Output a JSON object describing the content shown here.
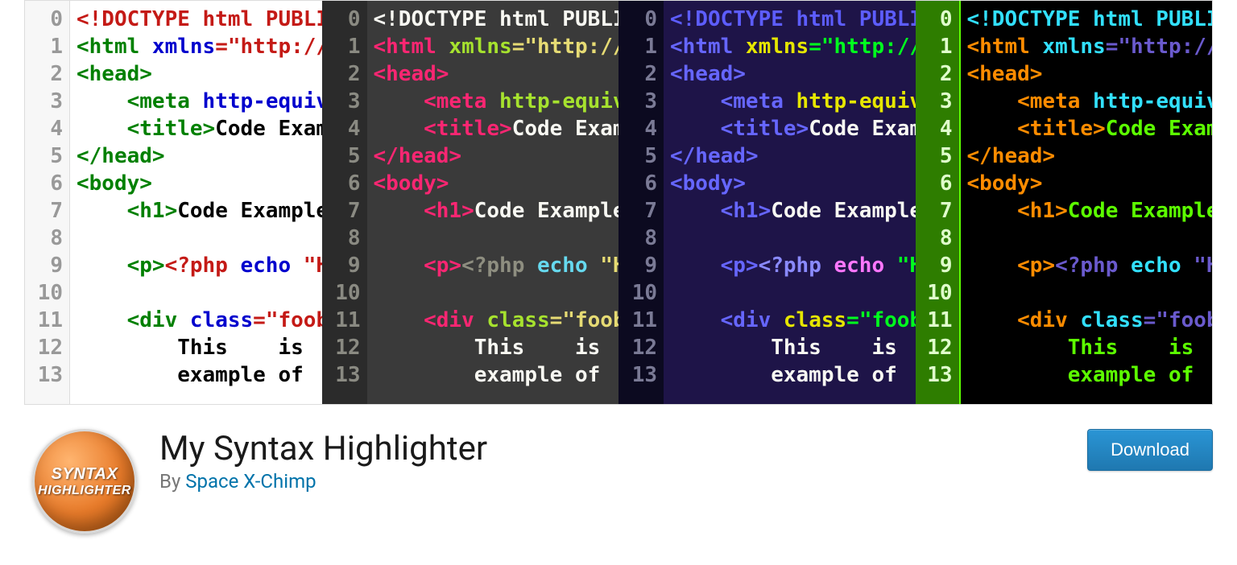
{
  "plugin": {
    "title": "My Syntax Highlighter",
    "by_prefix": "By ",
    "author": "Space X-Chimp",
    "download_label": "Download"
  },
  "logo": {
    "line1": "SYNTAX",
    "line2": "HIGHLIGHTER"
  },
  "panes": [
    {
      "id": "light",
      "gutter_start": 0,
      "gutter_end": 13,
      "tokens": [
        [
          {
            "t": "<!DOCTYPE html PUBLI",
            "c": "#c41a16"
          }
        ],
        [
          {
            "t": "<html ",
            "c": "#008000"
          },
          {
            "t": "xmlns",
            "c": "#0000cd"
          },
          {
            "t": "=\"http://",
            "c": "#c41a16"
          }
        ],
        [
          {
            "t": "<head>",
            "c": "#008000"
          }
        ],
        [
          {
            "t": "    <meta ",
            "c": "#008000"
          },
          {
            "t": "http-equiv",
            "c": "#0000cd"
          }
        ],
        [
          {
            "t": "    <title>",
            "c": "#008000"
          },
          {
            "t": "Code Exam",
            "c": "#000"
          }
        ],
        [
          {
            "t": "</head>",
            "c": "#008000"
          }
        ],
        [
          {
            "t": "<body>",
            "c": "#008000"
          }
        ],
        [
          {
            "t": "    <h1>",
            "c": "#008000"
          },
          {
            "t": "Code Example",
            "c": "#000"
          }
        ],
        [
          {
            "t": "",
            "c": "#000"
          }
        ],
        [
          {
            "t": "    <p>",
            "c": "#008000"
          },
          {
            "t": "<?php ",
            "c": "#c41a16"
          },
          {
            "t": "echo ",
            "c": "#0000cd"
          },
          {
            "t": "\"H",
            "c": "#c41a16"
          }
        ],
        [
          {
            "t": "",
            "c": "#000"
          }
        ],
        [
          {
            "t": "    <div ",
            "c": "#008000"
          },
          {
            "t": "class",
            "c": "#0000cd"
          },
          {
            "t": "=\"foob",
            "c": "#c41a16"
          }
        ],
        [
          {
            "t": "        This    is",
            "c": "#000"
          }
        ],
        [
          {
            "t": "        example of",
            "c": "#000"
          }
        ]
      ]
    },
    {
      "id": "dark",
      "gutter_start": 0,
      "gutter_end": 13,
      "tokens": [
        [
          {
            "t": "<!DOCTYPE html PUBLI",
            "c": "#f8f8f2"
          }
        ],
        [
          {
            "t": "<html ",
            "c": "#f92672"
          },
          {
            "t": "xmlns",
            "c": "#a6e22e"
          },
          {
            "t": "=\"http://",
            "c": "#e6db74"
          }
        ],
        [
          {
            "t": "<head>",
            "c": "#f92672"
          }
        ],
        [
          {
            "t": "    <meta ",
            "c": "#f92672"
          },
          {
            "t": "http-equiv",
            "c": "#a6e22e"
          }
        ],
        [
          {
            "t": "    <title>",
            "c": "#f92672"
          },
          {
            "t": "Code Exam",
            "c": "#f8f8f2"
          }
        ],
        [
          {
            "t": "</head>",
            "c": "#f92672"
          }
        ],
        [
          {
            "t": "<body>",
            "c": "#f92672"
          }
        ],
        [
          {
            "t": "    <h1>",
            "c": "#f92672"
          },
          {
            "t": "Code Example",
            "c": "#f8f8f2"
          }
        ],
        [
          {
            "t": "",
            "c": "#f8f8f2"
          }
        ],
        [
          {
            "t": "    <p>",
            "c": "#f92672"
          },
          {
            "t": "<?php ",
            "c": "#8e8e80"
          },
          {
            "t": "echo ",
            "c": "#66d9ef"
          },
          {
            "t": "\"H",
            "c": "#e6db74"
          }
        ],
        [
          {
            "t": "",
            "c": "#f8f8f2"
          }
        ],
        [
          {
            "t": "    <div ",
            "c": "#f92672"
          },
          {
            "t": "class",
            "c": "#a6e22e"
          },
          {
            "t": "=\"foob",
            "c": "#e6db74"
          }
        ],
        [
          {
            "t": "        This    is",
            "c": "#f8f8f2"
          }
        ],
        [
          {
            "t": "        example of",
            "c": "#f8f8f2"
          }
        ]
      ]
    },
    {
      "id": "night",
      "gutter_start": 0,
      "gutter_end": 13,
      "tokens": [
        [
          {
            "t": "<!DOCTYPE html PUBLI",
            "c": "#5d5dff"
          }
        ],
        [
          {
            "t": "<html ",
            "c": "#6666ff"
          },
          {
            "t": "xmlns",
            "c": "#e6e600"
          },
          {
            "t": "=\"http://",
            "c": "#00ff1e"
          }
        ],
        [
          {
            "t": "<head>",
            "c": "#6666ff"
          }
        ],
        [
          {
            "t": "    <meta ",
            "c": "#6666ff"
          },
          {
            "t": "http-equiv",
            "c": "#e6e600"
          }
        ],
        [
          {
            "t": "    <title>",
            "c": "#6666ff"
          },
          {
            "t": "Code Exam",
            "c": "#f8f8f2"
          }
        ],
        [
          {
            "t": "</head>",
            "c": "#6666ff"
          }
        ],
        [
          {
            "t": "<body>",
            "c": "#6666ff"
          }
        ],
        [
          {
            "t": "    <h1>",
            "c": "#6666ff"
          },
          {
            "t": "Code Example",
            "c": "#f8f8f2"
          }
        ],
        [
          {
            "t": "",
            "c": "#f8f8f2"
          }
        ],
        [
          {
            "t": "    <p>",
            "c": "#6666ff"
          },
          {
            "t": "<?php ",
            "c": "#8a8aff"
          },
          {
            "t": "echo ",
            "c": "#ff77ff"
          },
          {
            "t": "\"H",
            "c": "#00ff1e"
          }
        ],
        [
          {
            "t": "",
            "c": "#f8f8f2"
          }
        ],
        [
          {
            "t": "    <div ",
            "c": "#6666ff"
          },
          {
            "t": "class",
            "c": "#e6e600"
          },
          {
            "t": "=\"foob",
            "c": "#00ff1e"
          }
        ],
        [
          {
            "t": "        This    is",
            "c": "#f8f8f2"
          }
        ],
        [
          {
            "t": "        example of",
            "c": "#f8f8f2"
          }
        ]
      ]
    },
    {
      "id": "black",
      "gutter_start": 0,
      "gutter_end": 13,
      "tokens": [
        [
          {
            "t": "<!DOCTYPE html PUBLI",
            "c": "#32e0ff"
          }
        ],
        [
          {
            "t": "<html ",
            "c": "#ff8c00"
          },
          {
            "t": "xmlns",
            "c": "#32e0ff"
          },
          {
            "t": "=\"http://",
            "c": "#6a5acd"
          }
        ],
        [
          {
            "t": "<head>",
            "c": "#ff8c00"
          }
        ],
        [
          {
            "t": "    <meta ",
            "c": "#ff8c00"
          },
          {
            "t": "http-equiv",
            "c": "#32e0ff"
          }
        ],
        [
          {
            "t": "    <title>",
            "c": "#ff8c00"
          },
          {
            "t": "Code Exam",
            "c": "#5cff00"
          }
        ],
        [
          {
            "t": "</head>",
            "c": "#ff8c00"
          }
        ],
        [
          {
            "t": "<body>",
            "c": "#ff8c00"
          }
        ],
        [
          {
            "t": "    <h1>",
            "c": "#ff8c00"
          },
          {
            "t": "Code Example",
            "c": "#5cff00"
          }
        ],
        [
          {
            "t": "",
            "c": "#5cff00"
          }
        ],
        [
          {
            "t": "    <p>",
            "c": "#ff8c00"
          },
          {
            "t": "<?php ",
            "c": "#6a5acd"
          },
          {
            "t": "echo ",
            "c": "#32e0ff"
          },
          {
            "t": "\"H",
            "c": "#6a5acd"
          }
        ],
        [
          {
            "t": "",
            "c": "#5cff00"
          }
        ],
        [
          {
            "t": "    <div ",
            "c": "#ff8c00"
          },
          {
            "t": "class",
            "c": "#32e0ff"
          },
          {
            "t": "=\"foob",
            "c": "#6a5acd"
          }
        ],
        [
          {
            "t": "        This    is",
            "c": "#5cff00"
          }
        ],
        [
          {
            "t": "        example of",
            "c": "#5cff00"
          }
        ]
      ]
    }
  ]
}
